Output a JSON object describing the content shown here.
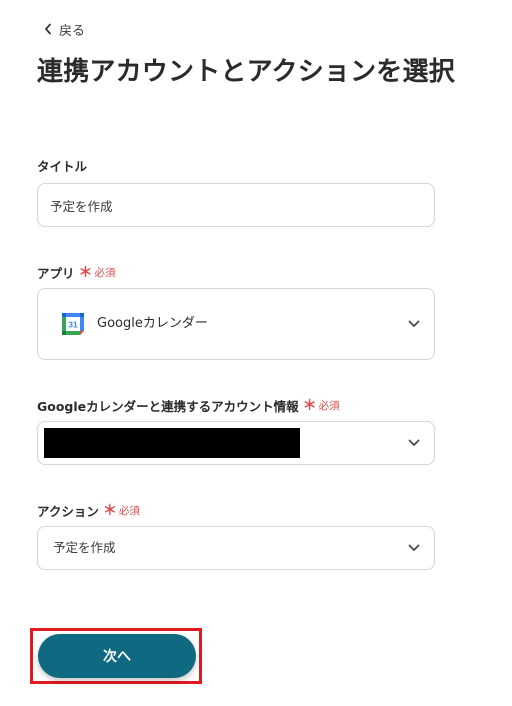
{
  "header": {
    "back_label": "戻る",
    "title": "連携アカウントとアクションを選択"
  },
  "form": {
    "title_field": {
      "label": "タイトル",
      "value": "予定を作成"
    },
    "app_field": {
      "label": "アプリ",
      "required_mark": "＊",
      "required_text": "必須",
      "value": "Googleカレンダー",
      "icon": "google-calendar-icon",
      "icon_text": "31"
    },
    "account_field": {
      "label": "Googleカレンダーと連携するアカウント情報",
      "required_mark": "＊",
      "required_text": "必須"
    },
    "action_field": {
      "label": "アクション",
      "required_mark": "＊",
      "required_text": "必須",
      "value": "予定を作成"
    }
  },
  "footer": {
    "next_label": "次へ"
  },
  "colors": {
    "primary_button": "#0f6981",
    "required": "#e04a4a",
    "highlight_border": "#e01a22",
    "border": "#d3d6da"
  }
}
